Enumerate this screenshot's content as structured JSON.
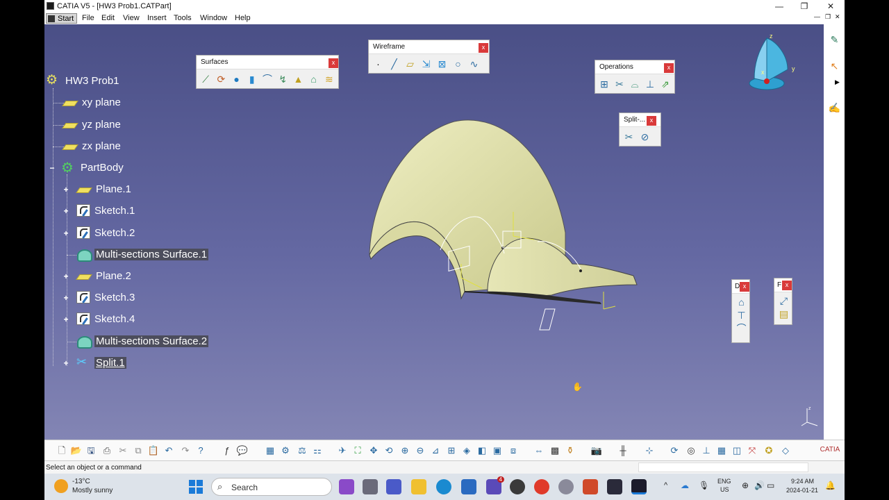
{
  "window": {
    "title": "CATIA V5 - [HW3 Prob1.CATPart]"
  },
  "menu": [
    "Start",
    "File",
    "Edit",
    "View",
    "Insert",
    "Tools",
    "Window",
    "Help"
  ],
  "tree": {
    "root": "HW3 Prob1",
    "items": [
      {
        "label": "xy plane",
        "icon": "plane-icon"
      },
      {
        "label": "yz plane",
        "icon": "plane-icon"
      },
      {
        "label": "zx plane",
        "icon": "plane-icon"
      },
      {
        "label": "PartBody",
        "icon": "partbody-icon"
      },
      {
        "label": "Plane.1",
        "icon": "plane-icon"
      },
      {
        "label": "Sketch.1",
        "icon": "sketch-icon"
      },
      {
        "label": "Sketch.2",
        "icon": "sketch-icon"
      },
      {
        "label": "Multi-sections Surface.1",
        "icon": "multi-sections-surface-icon"
      },
      {
        "label": "Plane.2",
        "icon": "plane-icon"
      },
      {
        "label": "Sketch.3",
        "icon": "sketch-icon"
      },
      {
        "label": "Sketch.4",
        "icon": "sketch-icon"
      },
      {
        "label": "Multi-sections Surface.2",
        "icon": "multi-sections-surface-icon"
      },
      {
        "label": "Split.1",
        "icon": "split-icon"
      }
    ]
  },
  "toolbars": {
    "surfaces": "Surfaces",
    "wireframe": "Wireframe",
    "operations": "Operations",
    "split": "Split-...",
    "small1": "D",
    "small2": "F",
    "close": "x"
  },
  "status": {
    "message": "Select an object or a command"
  },
  "taskbar": {
    "temperature": "-13°C",
    "weather": "Mostly sunny",
    "search": "Search",
    "lang": "ENG",
    "region": "US",
    "time": "9:24 AM",
    "date": "2024-01-21",
    "badge": "4"
  },
  "compass": {
    "x": "x",
    "y": "y",
    "z": "z"
  }
}
